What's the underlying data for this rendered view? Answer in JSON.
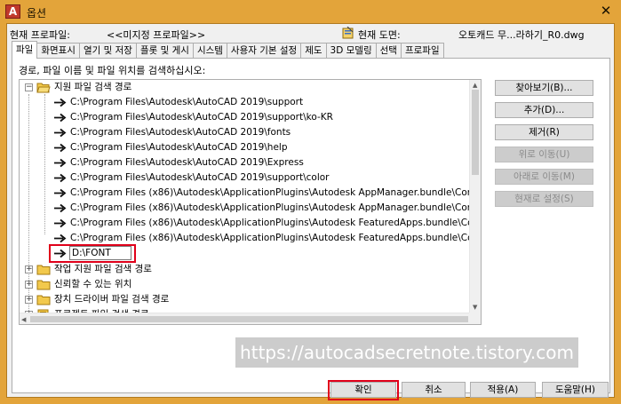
{
  "window": {
    "title": "옵션",
    "app_icon": "autocad-a-icon",
    "close_glyph": "✕"
  },
  "profile": {
    "current_profile_label": "현재 프로파일:",
    "current_profile_value": "<<미지정 프로파일>>",
    "current_drawing_label": "현재 도면:",
    "current_drawing_value": "오토캐드 무...라하기_R0.dwg"
  },
  "tabs": [
    {
      "label": "파일",
      "active": true
    },
    {
      "label": "화면표시"
    },
    {
      "label": "열기 및 저장"
    },
    {
      "label": "플롯 및 게시"
    },
    {
      "label": "시스템"
    },
    {
      "label": "사용자 기본 설정"
    },
    {
      "label": "제도"
    },
    {
      "label": "3D 모델링"
    },
    {
      "label": "선택"
    },
    {
      "label": "프로파일"
    }
  ],
  "instruction": "경로, 파일 이름 및 파일 위치를 검색하십시오:",
  "tree": {
    "root_label": "지원 파일 검색 경로",
    "paths": [
      "C:\\Program Files\\Autodesk\\AutoCAD 2019\\support",
      "C:\\Program Files\\Autodesk\\AutoCAD 2019\\support\\ko-KR",
      "C:\\Program Files\\Autodesk\\AutoCAD 2019\\fonts",
      "C:\\Program Files\\Autodesk\\AutoCAD 2019\\help",
      "C:\\Program Files\\Autodesk\\AutoCAD 2019\\Express",
      "C:\\Program Files\\Autodesk\\AutoCAD 2019\\support\\color",
      "C:\\Program Files (x86)\\Autodesk\\ApplicationPlugins\\Autodesk AppManager.bundle\\Con",
      "C:\\Program Files (x86)\\Autodesk\\ApplicationPlugins\\Autodesk AppManager.bundle\\Con",
      "C:\\Program Files (x86)\\Autodesk\\ApplicationPlugins\\Autodesk FeaturedApps.bundle\\Con",
      "C:\\Program Files (x86)\\Autodesk\\ApplicationPlugins\\Autodesk FeaturedApps.bundle\\Con"
    ],
    "edit_value": "D:\\FONT",
    "other_nodes": [
      "작업 지원 파일 검색 경로",
      "신뢰할 수 있는 위치",
      "장치 드라이버 파일 검색 경로",
      "프로젝트 파일 검색 경로"
    ]
  },
  "side_buttons": [
    {
      "label": "찾아보기(B)...",
      "enabled": true
    },
    {
      "label": "추가(D)...",
      "enabled": true
    },
    {
      "label": "제거(R)",
      "enabled": true
    },
    {
      "label": "위로 이동(U)",
      "enabled": false
    },
    {
      "label": "아래로 이동(M)",
      "enabled": false
    },
    {
      "label": "현재로 설정(S)",
      "enabled": false
    }
  ],
  "watermark": "https://autocadsecretnote.tistory.com",
  "bottom_buttons": {
    "ok": "확인",
    "cancel": "취소",
    "apply": "적용(A)",
    "help": "도움말(H)"
  },
  "colors": {
    "titlebar": "#e3a43a",
    "highlight_red": "#e0001a",
    "dialog_bg": "#f0f0f0"
  }
}
